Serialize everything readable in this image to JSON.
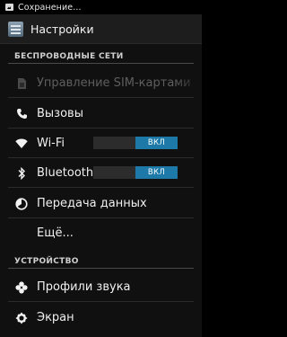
{
  "status_bar": {
    "notification_text": "Сохранение..."
  },
  "action_bar": {
    "title": "Настройки"
  },
  "sections": {
    "wireless": {
      "header": "БЕСПРОВОДНЫЕ СЕТИ",
      "sim_management": "Управление SIM-картами",
      "calls": "Вызовы",
      "wifi": "Wi-Fi",
      "wifi_toggle": "ВКЛ",
      "bluetooth": "Bluetooth",
      "bluetooth_toggle": "ВКЛ",
      "data_usage": "Передача данных",
      "more": "Ещё..."
    },
    "device": {
      "header": "УСТРОЙСТВО",
      "sound_profiles": "Профили звука",
      "display": "Экран"
    }
  },
  "colors": {
    "toggle_on": "#1c79a8",
    "background": "#101010"
  }
}
